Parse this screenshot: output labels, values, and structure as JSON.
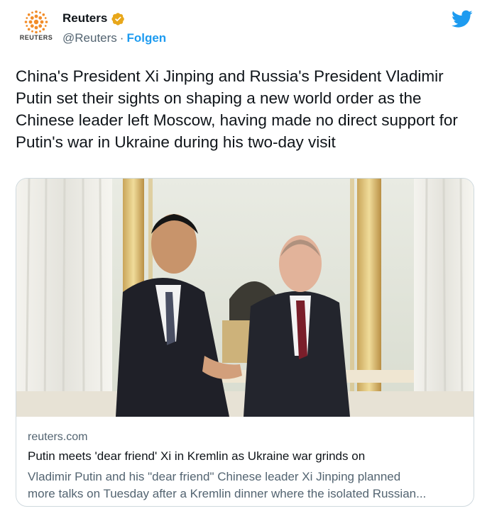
{
  "account": {
    "avatar_wordmark": "REUTERS",
    "display_name": "Reuters",
    "handle": "@Reuters",
    "separator": "·",
    "follow_label": "Folgen"
  },
  "tweet": {
    "text": "China's President Xi Jinping and Russia's President Vladimir Putin set their sights on shaping a new world order as the Chinese leader left Moscow, having made no direct support for Putin's war in Ukraine during his two-day visit"
  },
  "card": {
    "image_description": "Xi Jinping and Vladimir Putin shaking hands in the Kremlin",
    "domain": "reuters.com",
    "title": "Putin meets 'dear friend' Xi in Kremlin as Ukraine war grinds on",
    "description_line1": "Vladimir Putin and his \"dear friend\" Chinese leader Xi Jinping planned",
    "description_line2": "more talks on Tuesday after a Kremlin dinner where the isolated Russian..."
  },
  "colors": {
    "link": "#1d9bf0",
    "secondary_text": "#536471",
    "verified_badge": "#e8a71a",
    "brand_orange": "#f28c28"
  },
  "icons": [
    "reuters-logo-icon",
    "verified-badge-icon",
    "twitter-bird-icon"
  ]
}
